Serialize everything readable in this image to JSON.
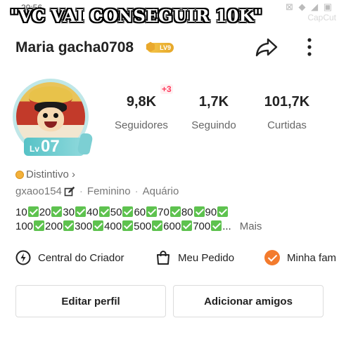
{
  "status_bar": {
    "time": "20:56",
    "icons": "⊠ ◆ ◢ ▣",
    "watermark": "CapCut"
  },
  "caption": "\"VC VAI CONSEGUIR 10K\"",
  "profile": {
    "username": "Maria gacha0708",
    "level_badge": "LV9",
    "avatar_level_prefix": "Lv",
    "avatar_level": "07",
    "handle": "gxaoo154",
    "gender": "Feminino",
    "sign": "Aquário",
    "distintivo": "Distintivo ›"
  },
  "stats": [
    {
      "value": "9,8K",
      "label": "Seguidores"
    },
    {
      "value": "1,7K",
      "label": "Seguindo"
    },
    {
      "value": "101,7K",
      "label": "Curtidas"
    }
  ],
  "new_followers_badge": "+3",
  "bio": {
    "line1": [
      "10",
      "20",
      "30",
      "40",
      "50",
      "60",
      "70",
      "80",
      "90"
    ],
    "line2": [
      "100",
      "200",
      "300",
      "400",
      "500",
      "600",
      "700"
    ],
    "ellipsis": "...",
    "more": "Mais"
  },
  "shortcuts": {
    "creator": "Central do Criador",
    "order": "Meu Pedido",
    "family": "Minha fam"
  },
  "buttons": {
    "edit": "Editar perfil",
    "add_friends": "Adicionar amigos"
  },
  "colors": {
    "accent_red": "#ff3b5c",
    "check_green": "#5ec24f",
    "level_teal": "#56c2c6",
    "badge_gold": "#f3b13a",
    "orange": "#f37b2d"
  }
}
